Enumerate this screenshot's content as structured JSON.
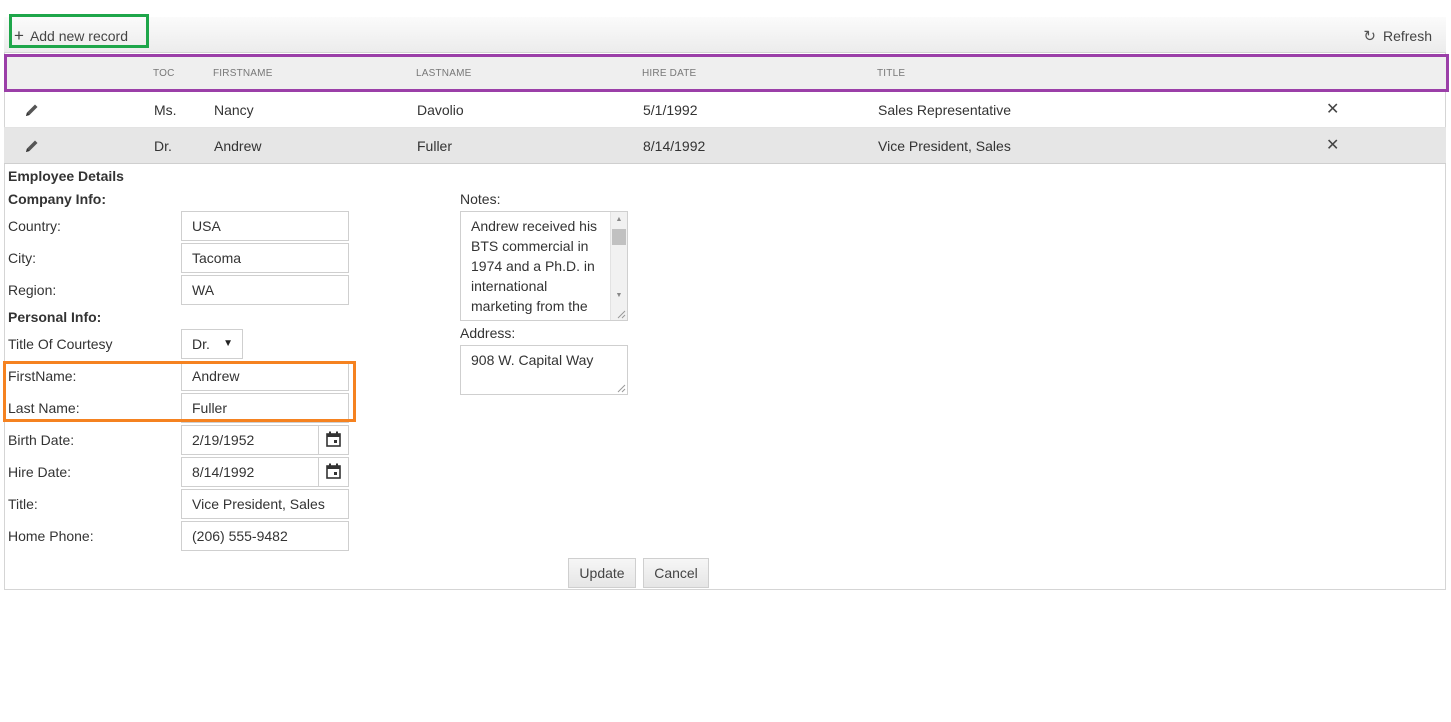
{
  "toolbar": {
    "add_label": "Add new record",
    "refresh_label": "Refresh"
  },
  "grid": {
    "columns": [
      "TOC",
      "FIRSTNAME",
      "LASTNAME",
      "HIRE DATE",
      "TITLE"
    ],
    "rows": [
      {
        "toc": "Ms.",
        "firstname": "Nancy",
        "lastname": "Davolio",
        "hire_date": "5/1/1992",
        "title": "Sales Representative"
      },
      {
        "toc": "Dr.",
        "firstname": "Andrew",
        "lastname": "Fuller",
        "hire_date": "8/14/1992",
        "title": "Vice President, Sales"
      }
    ]
  },
  "form": {
    "heading": "Employee Details",
    "company_heading": "Company Info:",
    "personal_heading": "Personal Info:",
    "country_label": "Country:",
    "country": "USA",
    "city_label": "City:",
    "city": "Tacoma",
    "region_label": "Region:",
    "region": "WA",
    "toc_label": "Title Of Courtesy",
    "toc": "Dr.",
    "firstname_label": "FirstName:",
    "firstname": "Andrew",
    "lastname_label": "Last Name:",
    "lastname": "Fuller",
    "birth_label": "Birth Date:",
    "birth": "2/19/1952",
    "hire_label": "Hire Date:",
    "hire": "8/14/1992",
    "title_label": "Title:",
    "title": "Vice President, Sales",
    "phone_label": "Home Phone:",
    "phone": "(206) 555-9482",
    "notes_label": "Notes:",
    "notes": "Andrew received his BTS commercial in 1974 and a Ph.D. in international marketing from the",
    "address_label": "Address:",
    "address": "908 W. Capital Way",
    "update_label": "Update",
    "cancel_label": "Cancel"
  },
  "colors": {
    "highlight_green": "#1ea64a",
    "highlight_purple": "#9b3fa8",
    "highlight_orange": "#f58220"
  }
}
